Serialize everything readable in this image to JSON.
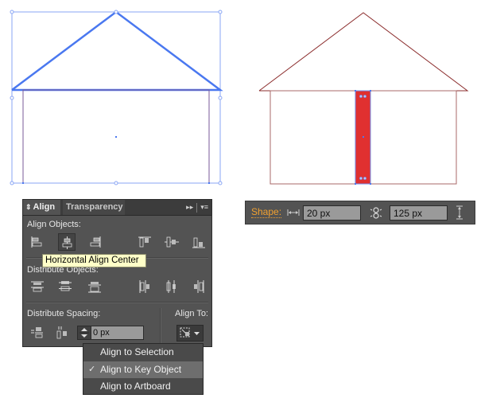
{
  "canvas": {
    "left_house": {
      "state": "selected",
      "selection_color": "#4a78f0",
      "wall_color": "#7a5a9a"
    },
    "right_house": {
      "stroke_color": "#8b2c2c",
      "door_fill": "#e03030",
      "door_selection": "#4a78f0"
    }
  },
  "align_panel": {
    "tabs": [
      {
        "label": "Align",
        "active": true,
        "updown_icon": "⇕"
      },
      {
        "label": "Transparency",
        "active": false
      }
    ],
    "controls": {
      "expand_icon": "▸▸",
      "menu_icon": "▾≡"
    },
    "align_objects": {
      "label": "Align Objects:",
      "buttons": [
        {
          "name": "horizontal-align-left",
          "selected": false
        },
        {
          "name": "horizontal-align-center",
          "selected": true
        },
        {
          "name": "horizontal-align-right",
          "selected": false
        },
        {
          "name": "vertical-align-top",
          "selected": false
        },
        {
          "name": "vertical-align-center",
          "selected": false
        },
        {
          "name": "vertical-align-bottom",
          "selected": false
        }
      ]
    },
    "tooltip": "Horizontal Align Center",
    "distribute_objects": {
      "label": "Distribute Objects:",
      "buttons": [
        "vertical-distribute-top",
        "vertical-distribute-center",
        "vertical-distribute-bottom",
        "horizontal-distribute-left",
        "horizontal-distribute-center",
        "horizontal-distribute-right"
      ]
    },
    "distribute_spacing": {
      "label": "Distribute Spacing:",
      "buttons": [
        "vertical-distribute-space",
        "horizontal-distribute-space"
      ],
      "value": "0 px"
    },
    "align_to": {
      "label": "Align To:",
      "options": [
        {
          "label": "Align to Selection",
          "checked": false,
          "highlighted": false
        },
        {
          "label": "Align to Key Object",
          "checked": true,
          "highlighted": true
        },
        {
          "label": "Align to Artboard",
          "checked": false,
          "highlighted": false
        }
      ],
      "check_glyph": "✓"
    }
  },
  "shape_bar": {
    "label": "Shape:",
    "width_value": "20 px",
    "height_value": "125 px",
    "label_color": "#f0a030"
  }
}
